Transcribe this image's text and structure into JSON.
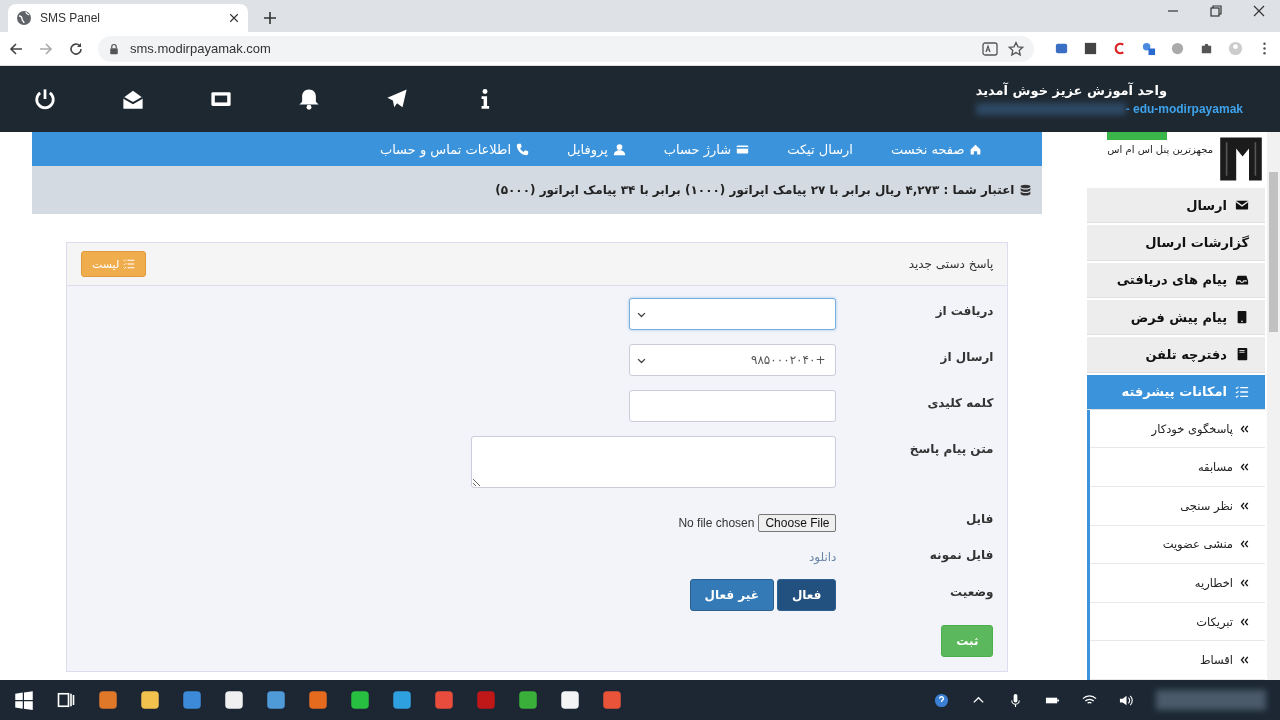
{
  "browser": {
    "tab": {
      "title": "SMS Panel"
    },
    "address": "sms.modirpayamak.com"
  },
  "header": {
    "welcome": "واحد آموزش عزیز خوش آمدید",
    "username": "- edu-modirpayamak"
  },
  "nav": [
    {
      "label": "صفحه نخست",
      "kind": "home"
    },
    {
      "label": "ارسال تیکت"
    },
    {
      "label": "شارژ حساب",
      "kind": "card"
    },
    {
      "label": "پروفایل",
      "kind": "user"
    },
    {
      "label": "اطلاعات تماس و حساب",
      "kind": "phone"
    }
  ],
  "credit": "اعتبار شما : ۴,۲۷۳ ریال برابر با ۲۷ پیامک اپراتور (۱۰۰۰) برابر با ۳۴ پیامک اپراتور (۵۰۰۰)",
  "form": {
    "title": "پاسخ دستی جدید",
    "list_button": "لیست",
    "fields": [
      {
        "kind": "select",
        "label": "دریافت از",
        "focused": true
      },
      {
        "kind": "select",
        "label": "ارسال از",
        "value": "۹۸۵۰۰۰۲۰۴۰+",
        "focused": false
      },
      {
        "kind": "text",
        "label": "کلمه کلیدی",
        "focused": false
      },
      {
        "kind": "textarea",
        "label": "متن پیام پاسخ",
        "focused": false
      },
      {
        "kind": "file",
        "label": "فایل",
        "button": "Choose File",
        "status": "No file chosen"
      },
      {
        "kind": "link",
        "label": "فایل نمونه",
        "text": "دانلود"
      },
      {
        "kind": "toggle",
        "label": "وضعیت",
        "options": [
          {
            "label": "فعال",
            "selected": true
          },
          {
            "label": "غیر فعال",
            "selected": false
          }
        ]
      }
    ],
    "submit": "ثبت"
  },
  "sidebar": {
    "tagline": "مجهزترین پنل اس ام اس",
    "items": [
      {
        "label": "ارسال",
        "kind": "envelope",
        "selected": false
      },
      {
        "label": "گزارشات ارسال",
        "selected": false
      },
      {
        "label": "پیام های دریافتی",
        "kind": "inbox",
        "selected": false
      },
      {
        "label": "پیام پیش فرض",
        "kind": "tablet",
        "selected": false
      },
      {
        "label": "دفترچه تلفن",
        "kind": "book",
        "selected": false
      },
      {
        "label": "امکانات پیشرفته",
        "kind": "list",
        "selected": true,
        "children": [
          {
            "label": "پاسخگوی خودکار"
          },
          {
            "label": "مسابقه"
          },
          {
            "label": "نظر سنجی"
          },
          {
            "label": "منشی عضویت"
          },
          {
            "label": "اخطاریه"
          },
          {
            "label": "تبریکات"
          },
          {
            "label": "اقساط"
          }
        ]
      }
    ]
  }
}
